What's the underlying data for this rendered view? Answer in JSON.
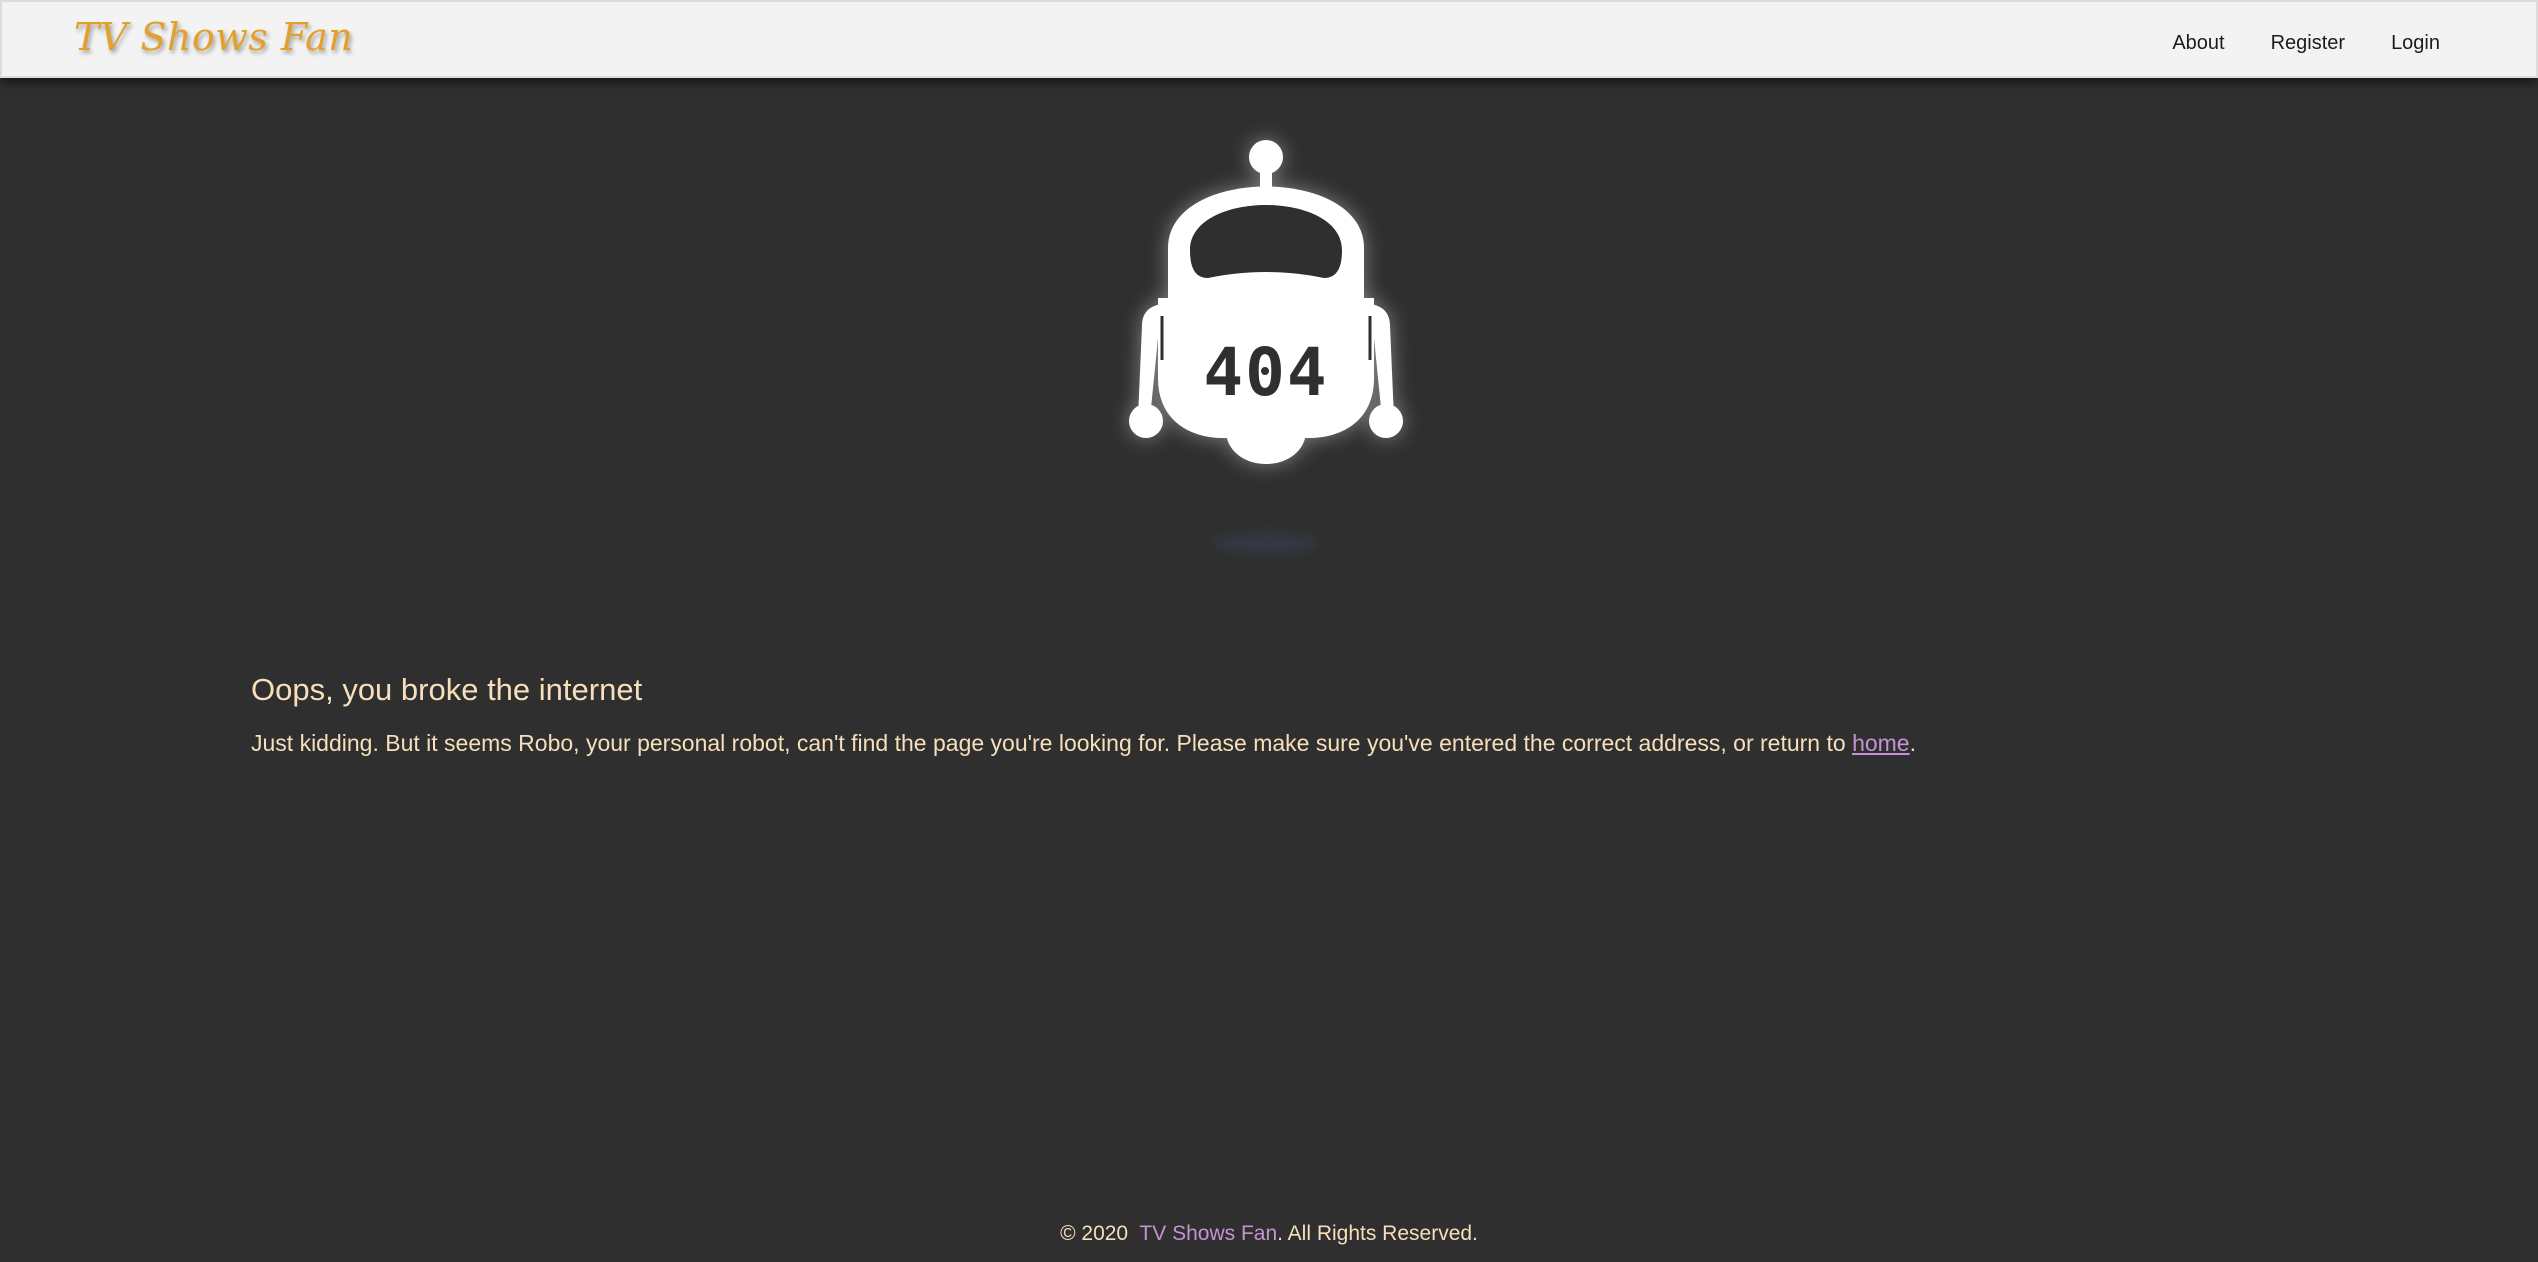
{
  "navbar": {
    "brand": "TV Shows Fan",
    "links": [
      {
        "label": "About"
      },
      {
        "label": "Register"
      },
      {
        "label": "Login"
      }
    ]
  },
  "robot": {
    "code": "404",
    "icon": "robot-icon"
  },
  "error": {
    "title": "Oops, you broke the internet",
    "text_before": "Just kidding. But it seems Robo, your personal robot, can't find the page you're looking for. Please make sure you've entered the correct address, or return to ",
    "link_label": "home",
    "text_after": "."
  },
  "footer": {
    "prefix": "© 2020",
    "brand": "TV Shows Fan",
    "suffix": ". All Rights Reserved."
  },
  "colors": {
    "background": "#2f2f2f",
    "navbar": "#f3f3f3",
    "brand": "#e3a02c",
    "text": "#f7dfbb",
    "link": "#c692d6"
  }
}
